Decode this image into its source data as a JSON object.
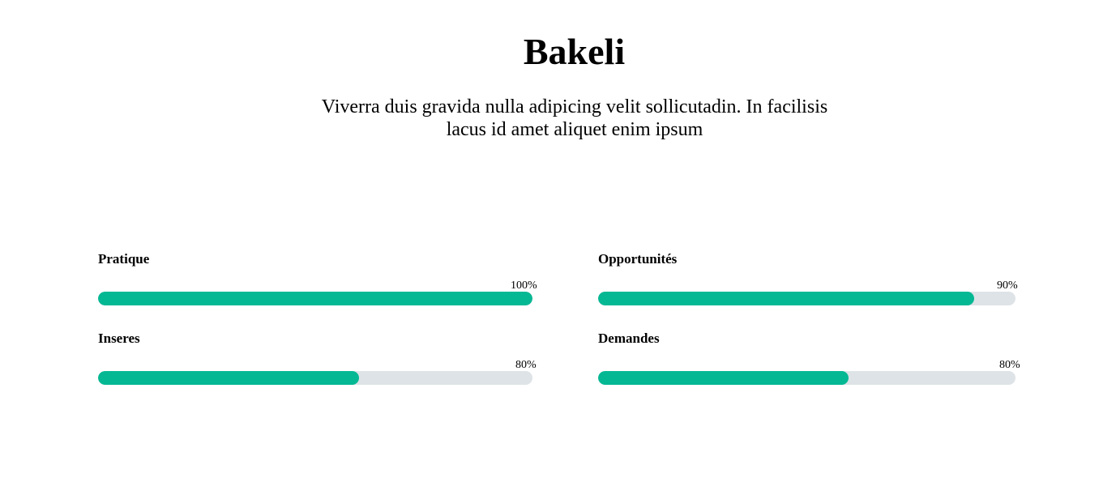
{
  "header": {
    "title": "Bakeli",
    "subtitle": "Viverra duis gravida nulla adipicing velit sollicutadin. In facilisis lacus id amet aliquet enim ipsum"
  },
  "colors": {
    "fill": "#05b894",
    "track": "#dee3e7"
  },
  "skills": [
    {
      "label": "Pratique",
      "percent_label": "100%",
      "fill_fraction": 1.0
    },
    {
      "label": "Opportunités",
      "percent_label": "90%",
      "fill_fraction": 0.9
    },
    {
      "label": "Inseres",
      "percent_label": "80%",
      "fill_fraction": 0.6
    },
    {
      "label": "Demandes",
      "percent_label": "80%",
      "fill_fraction": 0.6
    }
  ]
}
